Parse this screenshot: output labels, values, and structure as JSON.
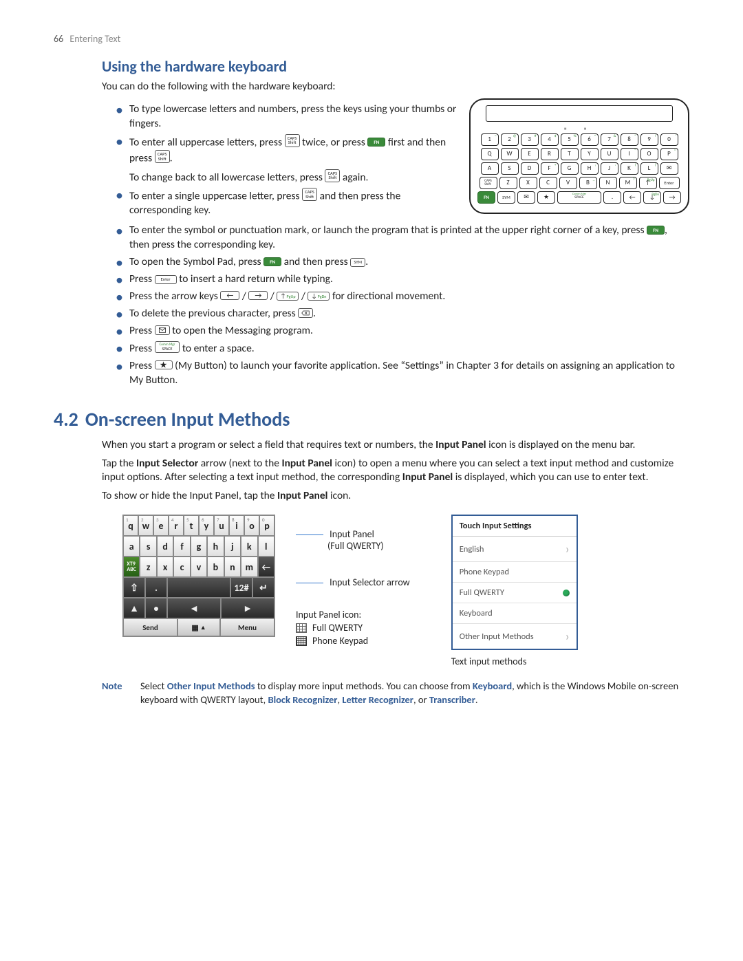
{
  "page": {
    "number": "66",
    "title": "Entering Text"
  },
  "section1": {
    "title": "Using the hardware keyboard",
    "intro": "You can do the following with the hardware keyboard:",
    "b1": "To type lowercase letters and numbers, press the keys using your thumbs or fingers.",
    "b2a": "To enter all uppercase letters, press ",
    "b2b": " twice, or press ",
    "b2c": " first and then press ",
    "b2d": ".",
    "b2sub_a": "To change back to all lowercase letters, press ",
    "b2sub_b": " again.",
    "b3a": "To enter a single uppercase letter, press ",
    "b3b": " and then press the corresponding key.",
    "b4a": "To enter the symbol or punctuation mark, or launch the program that is printed at the upper right corner of a key, press ",
    "b4b": ", then press the corresponding key.",
    "b5a": "To open the Symbol Pad, press ",
    "b5b": " and then press ",
    "b5c": ".",
    "b6a": "Press ",
    "b6b": " to insert a hard return while typing.",
    "b7a": "Press the arrow keys ",
    "b7b": " for directional movement.",
    "b8a": "To delete the previous character, press ",
    "b8b": ".",
    "b9a": "Press ",
    "b9b": " to open the Messaging program.",
    "b10a": "Press ",
    "b10b": " to enter a space.",
    "b11a": "Press ",
    "b11b": " (My Button) to launch your favorite application. See “Settings” in Chapter 3 for details on assigning an application to My Button."
  },
  "keys": {
    "caps": "CAPS\nShift",
    "fn": "FN",
    "sym": "SYM",
    "enter": "Enter",
    "space": "SPACE",
    "space_cm": "Comm Mgr",
    "pgup": "PgUp",
    "pgdn": "PgDn"
  },
  "hwkbd": {
    "row1": [
      {
        "m": "1",
        "s": "~"
      },
      {
        "m": "2",
        "s": "@"
      },
      {
        "m": "3",
        "s": "#"
      },
      {
        "m": "4",
        "s": "$"
      },
      {
        "m": "5",
        "s": "%"
      },
      {
        "m": "6",
        "s": "^"
      },
      {
        "m": "7",
        "s": "&"
      },
      {
        "m": "8",
        "s": "*"
      },
      {
        "m": "9",
        "s": "!"
      },
      {
        "m": "0",
        "s": "'"
      }
    ],
    "row2": [
      {
        "m": "Q"
      },
      {
        "m": "W"
      },
      {
        "m": "E"
      },
      {
        "m": "R"
      },
      {
        "m": "T"
      },
      {
        "m": "Y"
      },
      {
        "m": "U"
      },
      {
        "m": "I",
        "s": "\""
      },
      {
        "m": "O"
      },
      {
        "m": "P",
        "s": "="
      }
    ],
    "row3": [
      {
        "m": "A"
      },
      {
        "m": "S"
      },
      {
        "m": "D"
      },
      {
        "m": "F",
        "s": "+"
      },
      {
        "m": "G"
      },
      {
        "m": "H",
        "s": ";"
      },
      {
        "m": "J",
        "s": ":"
      },
      {
        "m": "K",
        "s": "("
      },
      {
        "m": "L",
        "s": ")"
      },
      {
        "m": "✉",
        "s": ""
      }
    ],
    "row4_left_caps": "CAPS\nShift",
    "row4": [
      {
        "m": "Z"
      },
      {
        "m": "X"
      },
      {
        "m": "C"
      },
      {
        "m": "V"
      },
      {
        "m": "B",
        "s": "_"
      },
      {
        "m": "N",
        "s": "-"
      },
      {
        "m": "M",
        "s": "?"
      }
    ]
  },
  "section2": {
    "num": "4.2",
    "title": "On-screen Input Methods",
    "p1a": "When you start a program or select a field that requires text or numbers, the ",
    "p1b": "Input Panel",
    "p1c": " icon is displayed on the menu bar.",
    "p2a": "Tap the ",
    "p2b": "Input Selector",
    "p2c": " arrow (next to the ",
    "p2d": "Input Panel",
    "p2e": " icon) to open a menu where you can select a text input method and customize input options. After selecting a text input method, the corresponding ",
    "p2f": "Input Panel",
    "p2g": " is displayed, which you can use to enter text.",
    "p3a": "To show or hide the Input Panel, tap the ",
    "p3b": "Input Panel",
    "p3c": " icon."
  },
  "softkbd": {
    "row1_nums": [
      "1",
      "2",
      "3",
      "4",
      "5",
      "6",
      "7",
      "8",
      "9",
      "0"
    ],
    "row1": [
      "q",
      "w",
      "e",
      "r",
      "t",
      "y",
      "u",
      "i",
      "o",
      "p"
    ],
    "row2": [
      "a",
      "s",
      "d",
      "f",
      "g",
      "h",
      "j",
      "k",
      "l"
    ],
    "xt9_top": "XT9",
    "xt9_bot": "ABC",
    "row3": [
      "z",
      "x",
      "c",
      "v",
      "b",
      "n",
      "m"
    ],
    "bksp": "←",
    "caps": ".",
    "shift": "▲",
    "num": "12#",
    "enter": "↵",
    "left": "◄",
    "right": "►",
    "send": "Send",
    "menu": "Menu",
    "sel": "▲"
  },
  "callouts": {
    "c1a": "Input Panel",
    "c1b": "(Full QWERTY)",
    "c2": "Input Selector arrow",
    "c3": "Input Panel icon:",
    "c3a": "Full QWERTY",
    "c3b": "Phone Keypad",
    "c4": "Text input methods"
  },
  "menu": {
    "header": "Touch Input Settings",
    "items": [
      {
        "label": "English",
        "type": "chev"
      },
      {
        "label": "Phone Keypad",
        "type": "none"
      },
      {
        "label": "Full QWERTY",
        "type": "dot"
      },
      {
        "label": "Keyboard",
        "type": "none"
      },
      {
        "label": "Other Input Methods",
        "type": "chev"
      }
    ]
  },
  "note": {
    "label": "Note",
    "t1": "Select ",
    "b1": "Other Input Methods",
    "t2": " to display more input methods. You can choose from ",
    "b2": "Keyboard",
    "t3": ", which is the Windows Mobile on-screen keyboard with QWERTY layout, ",
    "b3": "Block Recognizer",
    "t4": ", ",
    "b4": "Letter Recognizer",
    "t5": ", or ",
    "b5": "Transcriber",
    "t6": "."
  }
}
